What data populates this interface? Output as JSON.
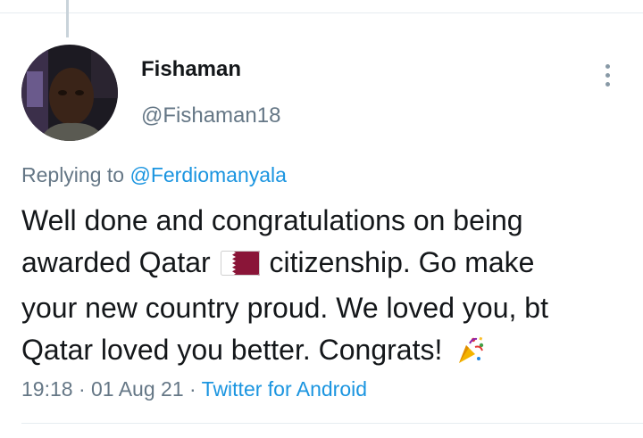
{
  "tweet": {
    "display_name": "Fishaman",
    "handle": "@Fishaman18",
    "replying_prefix": "Replying to",
    "replying_to": "@Ferdiomanyala",
    "text_line1": "Well done and congratulations on being",
    "text_line2a": "awarded Qatar",
    "text_line2b": "citizenship. Go make",
    "text_line3": "your new country proud. We loved you, bt",
    "text_line4": "Qatar loved you better. Congrats!",
    "time": "19:18",
    "date": "01 Aug 21",
    "source": "Twitter for Android",
    "separator": "·"
  },
  "icons": {
    "flag": "qatar-flag-emoji",
    "party": "party-popper-emoji",
    "menu": "more-vertical-icon"
  },
  "colors": {
    "name": "#14171a",
    "secondary": "#657786",
    "link": "#1b95e0",
    "qatar_maroon": "#8a1538"
  }
}
